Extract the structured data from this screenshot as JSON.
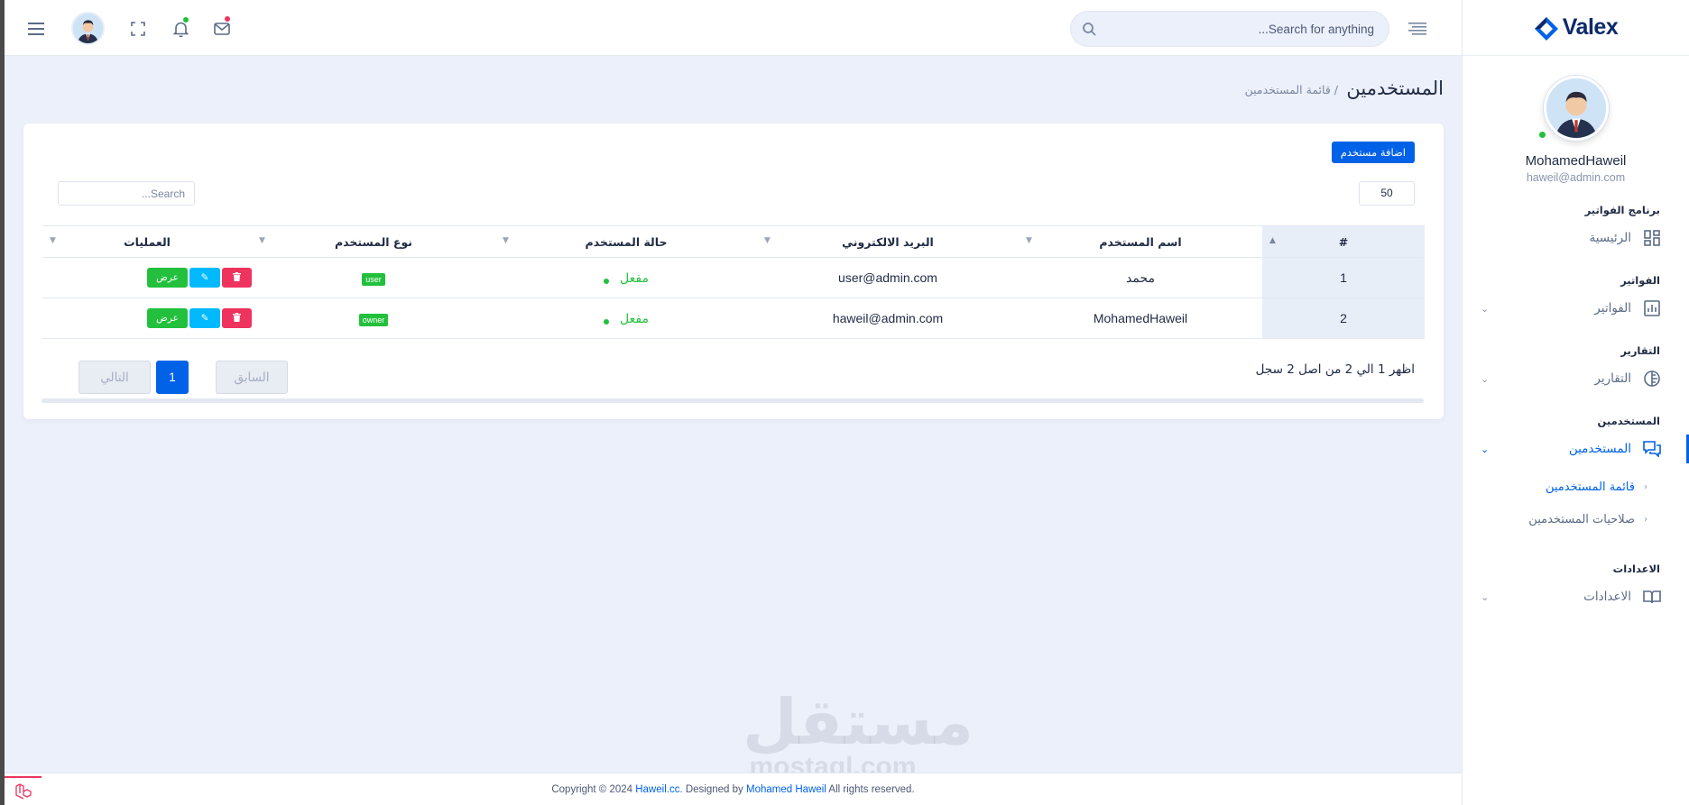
{
  "brand": {
    "name": "Valex"
  },
  "header": {
    "search_placeholder": "...Search for anything",
    "colors": {
      "bell_dot": "#22c03c",
      "mail_dot": "#ee335e"
    }
  },
  "profile": {
    "name": "MohamedHaweil",
    "email": "haweil@admin.com"
  },
  "sidebar": {
    "sections": [
      {
        "title": "برنامج الفواتير",
        "item": "الرئيسية",
        "icon": "dashboard-icon"
      },
      {
        "title": "الفواتير",
        "item": "الفواتير",
        "icon": "bar-chart-icon"
      },
      {
        "title": "التقارير",
        "item": "التقارير",
        "icon": "pie-chart-icon"
      },
      {
        "title": "المستخدمين",
        "item": "المستخدمين",
        "icon": "chat-icon"
      },
      {
        "title": "الاعدادات",
        "item": "الاعدادات",
        "icon": "book-icon"
      }
    ],
    "submenu": [
      "قائمة المستخدمين",
      "صلاحيات المستخدمين"
    ]
  },
  "page": {
    "title": "المستخدمين",
    "breadcrumb": "/ قائمة المستخدمين"
  },
  "toolbar": {
    "add_user": "اضافة مستخدم",
    "page_length": "50",
    "search_placeholder": "...Search"
  },
  "table": {
    "headers": [
      "#",
      "اسم المستخدم",
      "البريد الالكتروني",
      "حالة المستخدم",
      "نوع المستخدم",
      "العمليات"
    ],
    "rows": [
      {
        "index": "1",
        "name": "محمد",
        "email": "user@admin.com",
        "status": "مفعل",
        "type": "user"
      },
      {
        "index": "2",
        "name": "MohamedHaweil",
        "email": "haweil@admin.com",
        "status": "مفعل",
        "type": "owner"
      }
    ],
    "actions": {
      "view": "عرض",
      "edit": "✎",
      "delete": "🗑"
    }
  },
  "pagination": {
    "info": "اظهر 1 الي 2 من اصل 2 سجل",
    "prev": "السابق",
    "current": "1",
    "next": "التالي"
  },
  "watermark": {
    "ar": "مستقل",
    "en": "mostaql.com"
  },
  "footer": {
    "prefix": "Copyright © 2024",
    "site": "Haweil.cc",
    "designed_by": ". Designed by",
    "author": "Mohamed Haweil",
    "suffix": "All rights reserved."
  }
}
